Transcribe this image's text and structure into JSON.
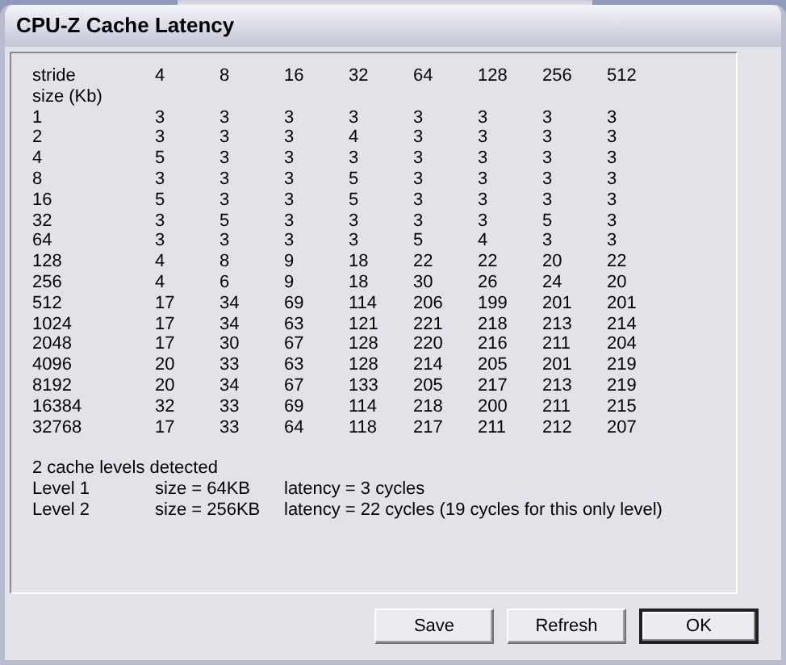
{
  "window": {
    "title": "CPU-Z Cache Latency"
  },
  "table": {
    "header": {
      "label": "stride",
      "values": [
        "4",
        "8",
        "16",
        "32",
        "64",
        "128",
        "256",
        "512"
      ]
    },
    "size_label": "size (Kb)",
    "rows": [
      {
        "size": "1",
        "values": [
          "3",
          "3",
          "3",
          "3",
          "3",
          "3",
          "3",
          "3"
        ]
      },
      {
        "size": "2",
        "values": [
          "3",
          "3",
          "3",
          "4",
          "3",
          "3",
          "3",
          "3"
        ]
      },
      {
        "size": "4",
        "values": [
          "5",
          "3",
          "3",
          "3",
          "3",
          "3",
          "3",
          "3"
        ]
      },
      {
        "size": "8",
        "values": [
          "3",
          "3",
          "3",
          "5",
          "3",
          "3",
          "3",
          "3"
        ]
      },
      {
        "size": "16",
        "values": [
          "5",
          "3",
          "3",
          "5",
          "3",
          "3",
          "3",
          "3"
        ]
      },
      {
        "size": "32",
        "values": [
          "3",
          "5",
          "3",
          "3",
          "3",
          "3",
          "5",
          "3"
        ]
      },
      {
        "size": "64",
        "values": [
          "3",
          "3",
          "3",
          "3",
          "5",
          "4",
          "3",
          "3"
        ]
      },
      {
        "size": "128",
        "values": [
          "4",
          "8",
          "9",
          "18",
          "22",
          "22",
          "20",
          "22"
        ]
      },
      {
        "size": "256",
        "values": [
          "4",
          "6",
          "9",
          "18",
          "30",
          "26",
          "24",
          "20"
        ]
      },
      {
        "size": "512",
        "values": [
          "17",
          "34",
          "69",
          "114",
          "206",
          "199",
          "201",
          "201"
        ]
      },
      {
        "size": "1024",
        "values": [
          "17",
          "34",
          "63",
          "121",
          "221",
          "218",
          "213",
          "214"
        ]
      },
      {
        "size": "2048",
        "values": [
          "17",
          "30",
          "67",
          "128",
          "220",
          "216",
          "211",
          "204"
        ]
      },
      {
        "size": "4096",
        "values": [
          "20",
          "33",
          "63",
          "128",
          "214",
          "205",
          "201",
          "219"
        ]
      },
      {
        "size": "8192",
        "values": [
          "20",
          "34",
          "67",
          "133",
          "205",
          "217",
          "213",
          "219"
        ]
      },
      {
        "size": "16384",
        "values": [
          "32",
          "33",
          "69",
          "114",
          "218",
          "200",
          "211",
          "215"
        ]
      },
      {
        "size": "32768",
        "values": [
          "17",
          "33",
          "64",
          "118",
          "217",
          "211",
          "212",
          "207"
        ]
      }
    ]
  },
  "summary": {
    "heading": "2 cache levels detected",
    "levels": [
      {
        "label": "Level 1",
        "size": "size = 64KB",
        "latency": "latency = 3 cycles"
      },
      {
        "label": "Level 2",
        "size": "size = 256KB",
        "latency": "latency = 22 cycles (19 cycles for this only level)"
      }
    ]
  },
  "buttons": [
    {
      "label": "Save",
      "default": false
    },
    {
      "label": "Refresh",
      "default": false
    },
    {
      "label": "OK",
      "default": true
    }
  ]
}
